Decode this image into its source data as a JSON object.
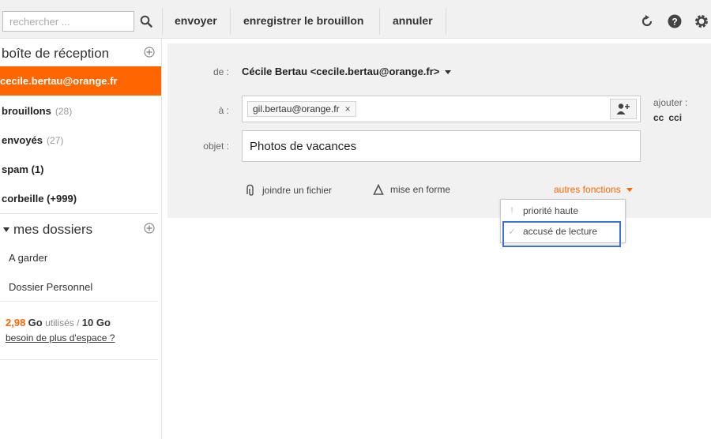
{
  "toolbar": {
    "search_placeholder": "rechercher ...",
    "send_label": "envoyer",
    "save_draft_label": "enregistrer le brouillon",
    "cancel_label": "annuler"
  },
  "sidebar": {
    "inbox_title": "boîte de réception",
    "account": "cecile.bertau@orange.fr",
    "items": [
      {
        "label": "brouillons",
        "count": "(28)"
      },
      {
        "label": "envoyés",
        "count": "(27)"
      },
      {
        "label": "spam (1)",
        "count": ""
      },
      {
        "label": "corbeille (+999)",
        "count": ""
      }
    ],
    "folders_title": "mes dossiers",
    "folders": [
      "A garder",
      "Dossier Personnel"
    ],
    "storage": {
      "used": "2,98",
      "used_unit": "Go",
      "used_text": "utilisés /",
      "total": "10 Go",
      "more_space_link": "besoin de plus d'espace ?"
    }
  },
  "compose": {
    "from_label": "de :",
    "from_value": "Cécile Bertau <cecile.bertau@orange.fr>",
    "to_label": "à :",
    "to_chip": "gil.bertau@orange.fr",
    "to_chip_remove": "×",
    "add_label": "ajouter :",
    "cc_label": "cc",
    "cci_label": "cci",
    "subject_label": "objet :",
    "subject_value": "Photos de vacances",
    "attach_label": "joindre un fichier",
    "format_label": "mise en forme",
    "more_label": "autres fonctions"
  },
  "dropdown": {
    "items": [
      {
        "mark": "!",
        "label": "priorité haute"
      },
      {
        "mark": "✓",
        "label": "accusé de lecture"
      }
    ]
  },
  "colors": {
    "accent": "#ff6600",
    "highlight": "#3e6fd8",
    "panel": "#f1f1f1"
  }
}
